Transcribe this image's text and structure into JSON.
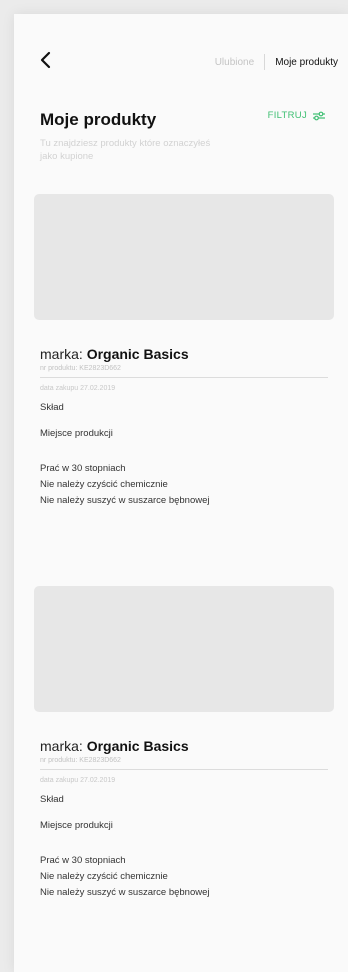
{
  "nav": {
    "tabs": [
      {
        "label": "Ulubione",
        "active": false
      },
      {
        "label": "Moje produkty",
        "active": true
      }
    ]
  },
  "header": {
    "title": "Moje produkty",
    "subtitle": "Tu znajdziesz produkty które oznaczyłeś jako kupione",
    "filter_label": "FILTRUJ"
  },
  "products": [
    {
      "brand_prefix": "marka:",
      "brand_name": "Organic Basics",
      "product_number": "nr produktu: KE2823D662",
      "purchase_date": "data zakupu 27.02.2019",
      "composition_label": "Skład",
      "origin_label": "Miejsce produkcji",
      "care": [
        "Prać w 30 stopniach",
        "Nie należy czyścić chemicznie",
        "Nie należy suszyć w suszarce bębnowej"
      ]
    },
    {
      "brand_prefix": "marka:",
      "brand_name": "Organic Basics",
      "product_number": "nr produktu: KE2823D662",
      "purchase_date": "data zakupu 27.02.2019",
      "composition_label": "Skład",
      "origin_label": "Miejsce produkcji",
      "care": [
        "Prać w 30 stopniach",
        "Nie należy czyścić chemicznie",
        "Nie należy suszyć w suszarce bębnowej"
      ]
    }
  ],
  "colors": {
    "accent": "#3fbf73",
    "background": "#fafafa",
    "image_placeholder": "#e7e7e7"
  },
  "icons": {
    "back": "chevron-left-icon",
    "filter": "sliders-icon"
  }
}
